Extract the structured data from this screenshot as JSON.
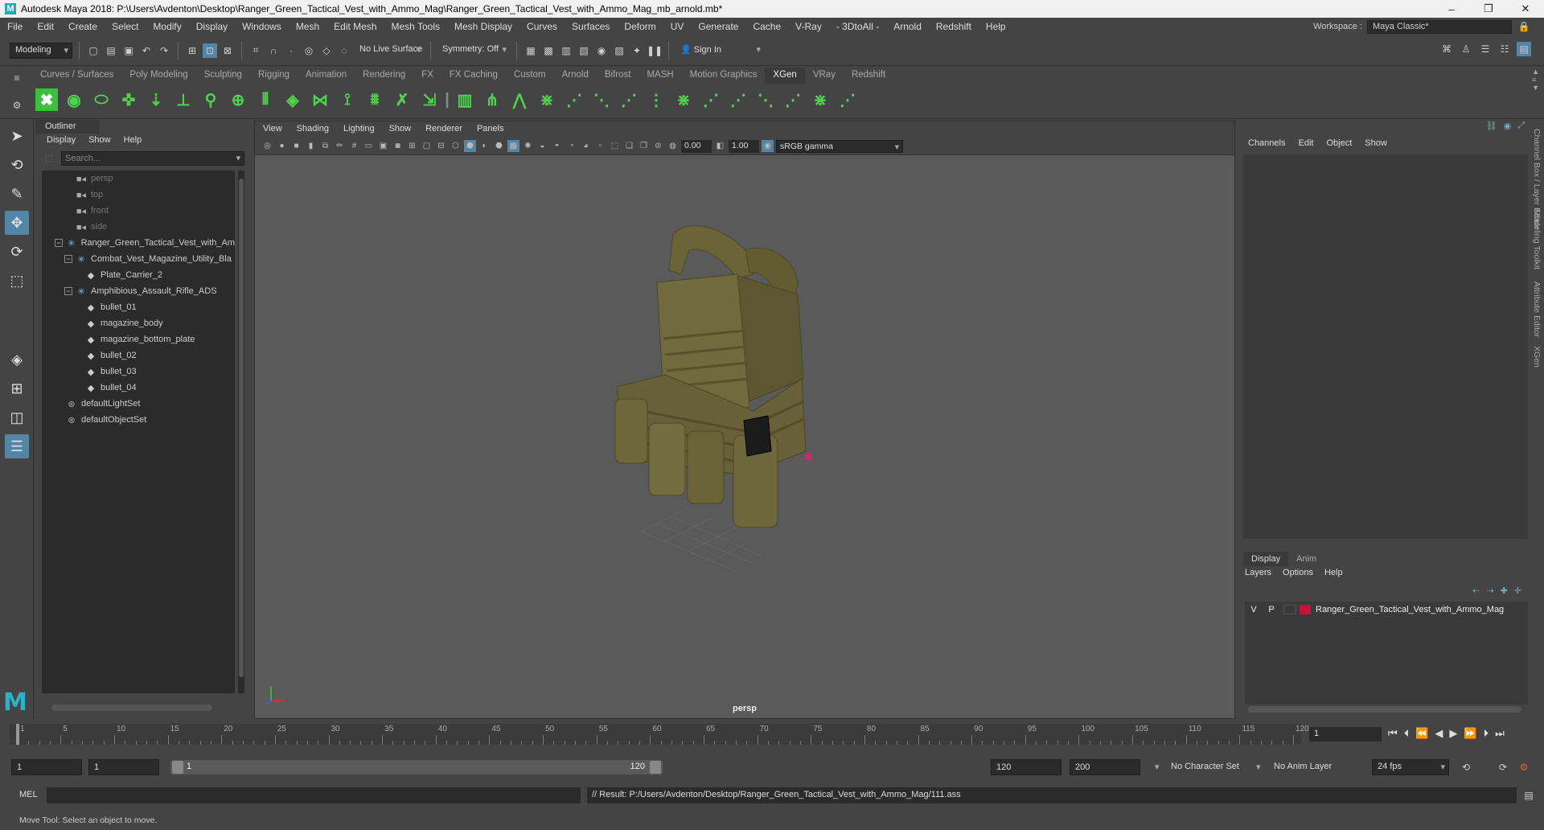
{
  "window": {
    "title": "Autodesk Maya 2018: P:\\Users\\Avdenton\\Desktop\\Ranger_Green_Tactical_Vest_with_Ammo_Mag\\Ranger_Green_Tactical_Vest_with_Ammo_Mag_mb_arnold.mb*",
    "logo_letter": "M",
    "minimize": "–",
    "maximize": "❐",
    "close": "✕"
  },
  "menubar": {
    "items": [
      "File",
      "Edit",
      "Create",
      "Select",
      "Modify",
      "Display",
      "Windows",
      "Mesh",
      "Edit Mesh",
      "Mesh Tools",
      "Mesh Display",
      "Curves",
      "Surfaces",
      "Deform",
      "UV",
      "Generate",
      "Cache",
      "V-Ray",
      "- 3DtoAll -",
      "Arnold",
      "Redshift",
      "Help"
    ],
    "workspace_label": "Workspace :",
    "workspace_value": "Maya Classic*"
  },
  "statusline": {
    "mode": "Modeling",
    "live_surface": "No Live Surface",
    "symmetry": "Symmetry: Off",
    "sign_in": "Sign In"
  },
  "shelf": {
    "tabs": [
      "Curves / Surfaces",
      "Poly Modeling",
      "Sculpting",
      "Rigging",
      "Animation",
      "Rendering",
      "FX",
      "FX Caching",
      "Custom",
      "Arnold",
      "Bifrost",
      "MASH",
      "Motion Graphics",
      "XGen",
      "VRay",
      "Redshift"
    ],
    "active_tab": "XGen",
    "icon_count_hint": "xgen-tools"
  },
  "outliner": {
    "title": "Outliner",
    "menu": [
      "Display",
      "Show",
      "Help"
    ],
    "search_placeholder": "Search...",
    "rows": [
      {
        "label": "persp",
        "icon": "camera-icon",
        "indent": 2,
        "dim": true,
        "exp": ""
      },
      {
        "label": "top",
        "icon": "camera-icon",
        "indent": 2,
        "dim": true,
        "exp": ""
      },
      {
        "label": "front",
        "icon": "camera-icon",
        "indent": 2,
        "dim": true,
        "exp": ""
      },
      {
        "label": "side",
        "icon": "camera-icon",
        "indent": 2,
        "dim": true,
        "exp": ""
      },
      {
        "label": "Ranger_Green_Tactical_Vest_with_Am",
        "icon": "group-icon",
        "indent": 1,
        "dim": false,
        "exp": "−"
      },
      {
        "label": "Combat_Vest_Magazine_Utility_Bla",
        "icon": "group-icon",
        "indent": 2,
        "dim": false,
        "exp": "−"
      },
      {
        "label": "Plate_Carrier_2",
        "icon": "mesh-icon",
        "indent": 3,
        "dim": false,
        "exp": ""
      },
      {
        "label": "Amphibious_Assault_Rifle_ADS",
        "icon": "group-icon",
        "indent": 2,
        "dim": false,
        "exp": "−"
      },
      {
        "label": "bullet_01",
        "icon": "mesh-icon",
        "indent": 3,
        "dim": false,
        "exp": ""
      },
      {
        "label": "magazine_body",
        "icon": "mesh-icon",
        "indent": 3,
        "dim": false,
        "exp": ""
      },
      {
        "label": "magazine_bottom_plate",
        "icon": "mesh-icon",
        "indent": 3,
        "dim": false,
        "exp": ""
      },
      {
        "label": "bullet_02",
        "icon": "mesh-icon",
        "indent": 3,
        "dim": false,
        "exp": ""
      },
      {
        "label": "bullet_03",
        "icon": "mesh-icon",
        "indent": 3,
        "dim": false,
        "exp": ""
      },
      {
        "label": "bullet_04",
        "icon": "mesh-icon",
        "indent": 3,
        "dim": false,
        "exp": ""
      },
      {
        "label": "defaultLightSet",
        "icon": "set-icon",
        "indent": 1,
        "dim": false,
        "exp": ""
      },
      {
        "label": "defaultObjectSet",
        "icon": "set-icon",
        "indent": 1,
        "dim": false,
        "exp": ""
      }
    ]
  },
  "viewport": {
    "menu": [
      "View",
      "Shading",
      "Lighting",
      "Show",
      "Renderer",
      "Panels"
    ],
    "exposure": "0.00",
    "gamma": "1.00",
    "color_space": "sRGB gamma",
    "camera": "persp",
    "model_color": "#6b6439"
  },
  "channelbox": {
    "menu": [
      "Channels",
      "Edit",
      "Object",
      "Show"
    ],
    "layer_tabs": [
      "Display",
      "Anim"
    ],
    "layer_menu": [
      "Layers",
      "Options",
      "Help"
    ],
    "layer": {
      "v": "V",
      "p": "P",
      "name": "Ranger_Green_Tactical_Vest_with_Ammo_Mag",
      "color": "#c4143c"
    }
  },
  "side_tabs": [
    "Channel Box / Layer Editor",
    "Modeling Toolkit",
    "Attribute Editor",
    "XGen"
  ],
  "timeslider": {
    "labels": [
      "1",
      "5",
      "10",
      "15",
      "20",
      "25",
      "30",
      "35",
      "40",
      "45",
      "50",
      "55",
      "60",
      "65",
      "70",
      "75",
      "80",
      "85",
      "90",
      "95",
      "100",
      "105",
      "110",
      "115",
      "120"
    ],
    "current_frame": "1"
  },
  "rangeslider": {
    "start": "1",
    "playback_start": "1",
    "range_start": "1",
    "range_end": "120",
    "playback_end": "120",
    "end": "200",
    "character_set": "No Character Set",
    "anim_layer": "No Anim Layer",
    "fps": "24 fps"
  },
  "cmdline": {
    "label": "MEL",
    "result": "// Result: P:/Users/Avdenton/Desktop/Ranger_Green_Tactical_Vest_with_Ammo_Mag/111.ass"
  },
  "helpline": {
    "text": "Move Tool: Select an object to move."
  }
}
